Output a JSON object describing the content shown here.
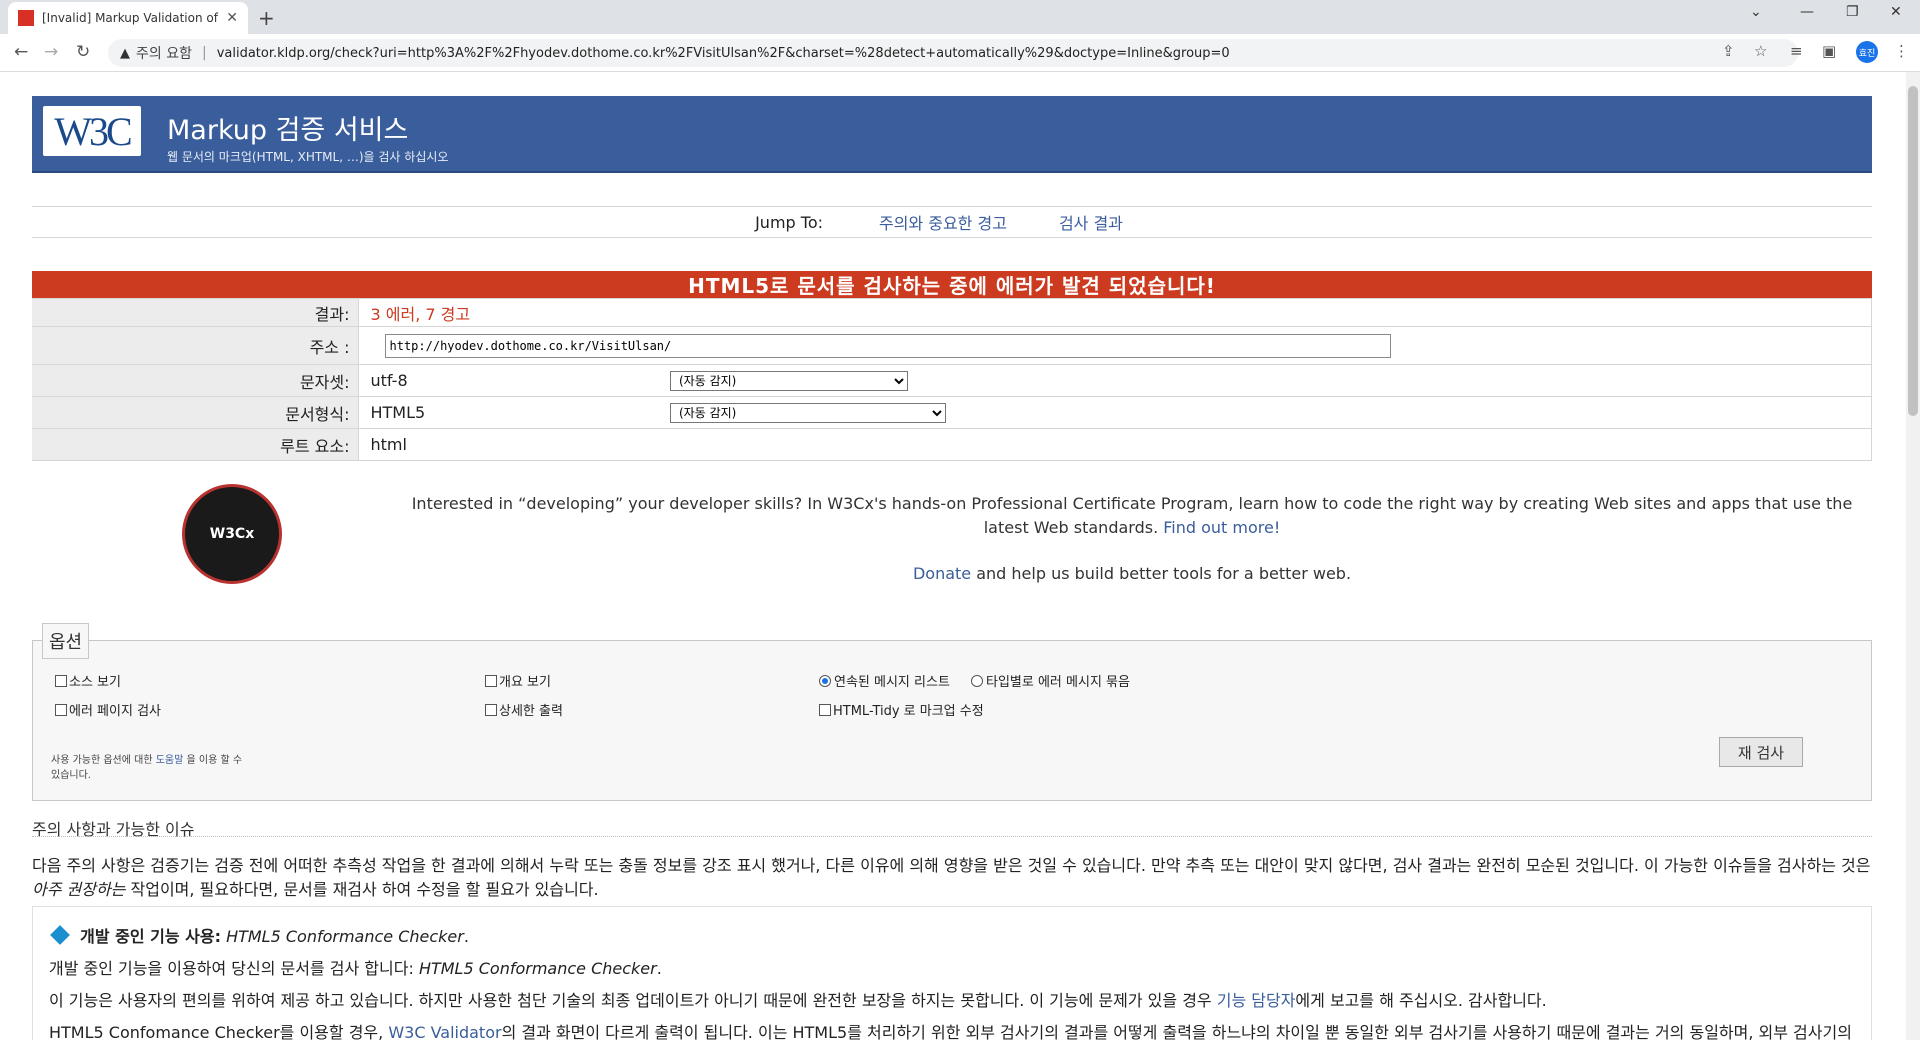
{
  "browser": {
    "tab_title": "[Invalid] Markup Validation of h",
    "new_tab": "+",
    "security_label": "주의 요함",
    "url": "validator.kldp.org/check?uri=http%3A%2F%2Fhyodev.dothome.co.kr%2FVisitUlsan%2F&charset=%28detect+automatically%29&doctype=Inline&group=0",
    "profile_initials": "효진"
  },
  "header": {
    "title": "Markup 검증 서비스",
    "subtitle": "웹 문서의 마크업(HTML, XHTML, …)을 검사 하십시오",
    "logo_text": "W3C"
  },
  "jump": {
    "label": "Jump To:",
    "links": [
      "주의와 중요한 경고",
      "검사 결과"
    ]
  },
  "result_banner": "HTML5로 문서를 검사하는 중에 에러가 발견 되었습니다!",
  "result_table": {
    "result_label": "결과:",
    "result_value": "3 에러, 7 경고",
    "address_label": "주소 :",
    "address_value": "http://hyodev.dothome.co.kr/VisitUlsan/",
    "charset_label": "문자셋:",
    "charset_value": "utf-8",
    "charset_select": "(자동 감지)",
    "doctype_label": "문서형식:",
    "doctype_value": "HTML5",
    "doctype_select": "(자동 감지)",
    "root_label": "루트 요소:",
    "root_value": "html"
  },
  "promo": {
    "logo_text": "W3Cx",
    "text": "Interested in “developing” your developer skills? In W3Cx's hands-on Professional Certificate Program, learn how to code the right way by creating Web sites and apps that use the latest Web standards.",
    "link": "Find out more!",
    "donate_link": "Donate",
    "donate_text": "and help us build better tools for a better web."
  },
  "options": {
    "legend": "옵션",
    "show_source": "소스 보기",
    "outline": "개요 보기",
    "sequential": "연속된 메시지 리스트",
    "grouped": "타입별로 에러 메시지 묶음",
    "error_pages": "에러 페이지 검사",
    "verbose": "상세한 출력",
    "tidy": "HTML-Tidy 로 마크업 수정",
    "help_prefix": "사용 가능한 옵션에 대한",
    "help_link": "도움말",
    "help_suffix": "을 이용 할 수 있습니다.",
    "recheck": "재 검사"
  },
  "notices": {
    "title": "주의 사항과 가능한 이슈",
    "paragraph_1": "다음 주의 사항은 검증기는 검증 전에 어떠한 추측성 작업을 한 결과에 의해서 누락 또는 충돌 정보를 강조 표시 했거나, 다른 이유에 의해 영향을 받은 것일 수 있습니다. 만약 추측 또는 대안이 맞지 않다면, 검사 결과는 완전히 모순된 것입니다. 이 가능한 이슈들을 검사하는 것은",
    "emphasis": "아주 권장하는",
    "paragraph_2": "작업이며, 필요하다면, 문서를 재검사 하여 수정을 할 필요가 있습니다.",
    "feature_title": "개발 중인 기능 사용:",
    "feature_name": "HTML5 Conformance Checker",
    "line1": "개발 중인 기능을 이용하여 당신의 문서를 검사 합니다:",
    "line2_a": "이 기능은 사용자의 편의를 위하여 제공 하고 있습니다. 하지만 사용한 첨단 기술의 최종 업데이트가 아니기 때문에 완전한 보장을 하지는 못합니다. 이 기능에 문제가 있을 경우",
    "line2_link": "기능 담당자",
    "line2_b": "에게 보고를 해 주십시오. 감사합니다.",
    "line3_a": "HTML5 Confomance Checker를 이용할 경우,",
    "line3_link": "W3C Validator",
    "line3_b": "의 결과 화면이 다르게 출력이 됩니다. 이는 HTML5를 처리하기 위한 외부 검사기의 결과를 어떻게 출력을 하느냐의 차이일 뿐 동일한 외부 검사기를 사용하기 때문에 결과는 거의 동일하며, 외부 검사기의"
  },
  "colors": {
    "banner": "#3a5d9b",
    "error": "#cc3a20",
    "link": "#3a5d9b"
  }
}
